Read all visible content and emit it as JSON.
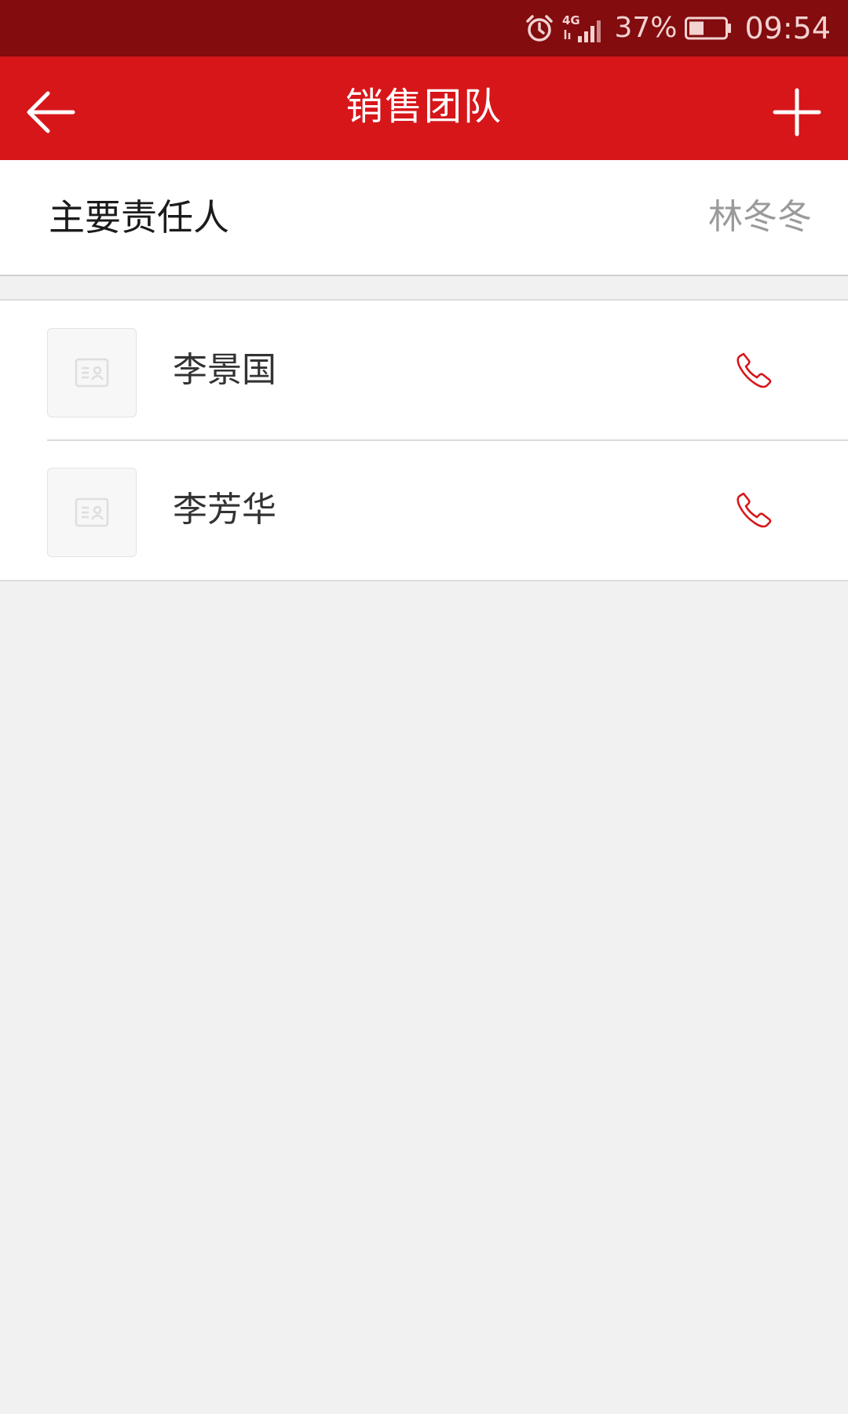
{
  "status_bar": {
    "network": "4G",
    "battery": "37%",
    "time": "09:54"
  },
  "header": {
    "title": "销售团队"
  },
  "owner": {
    "label": "主要责任人",
    "name": "林冬冬"
  },
  "team": {
    "members": [
      {
        "name": "李景国"
      },
      {
        "name": "李芳华"
      }
    ]
  },
  "colors": {
    "status_bar": "#820c0e",
    "header": "#d7161a",
    "phone_icon": "#d7161a",
    "background": "#f1f1f1"
  }
}
